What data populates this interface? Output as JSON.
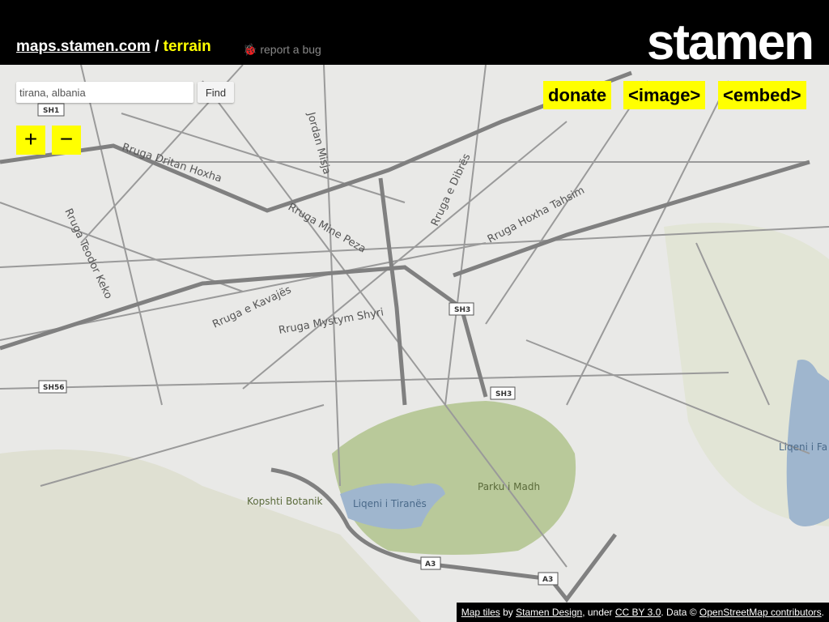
{
  "header": {
    "site_link": "maps.stamen.com",
    "separator": "/",
    "layer": "terrain",
    "report_bug": "report a bug",
    "logo": "stamen"
  },
  "search": {
    "value": "tirana, albania",
    "button": "Find"
  },
  "zoom": {
    "in": "+",
    "out": "−"
  },
  "actions": {
    "donate": "donate",
    "image": "<image>",
    "embed": "<embed>"
  },
  "attribution": {
    "map_tiles": "Map tiles",
    "by": " by ",
    "stamen_design": "Stamen Design",
    "under": ", under ",
    "license": "CC BY 3.0",
    "data": ". Data © ",
    "osm": "OpenStreetMap contributors",
    "end": "."
  },
  "map": {
    "colors": {
      "land": "#e9e9e7",
      "park": "#b9c99a",
      "water": "#9fb6ce",
      "road": "#9a9a9a",
      "major_road": "#7a7a7a"
    },
    "street_labels": [
      "Rruga Dritan Hoxha",
      "Jordan Misja",
      "Rruga e Dibrës",
      "Rruga Hoxha Tahsim",
      "Rruga Mine Peza",
      "Rruga Teodor Keko",
      "Rruga e Kavajës",
      "Rruga Mystym Shyri"
    ],
    "place_labels": [
      "Kopshti Botanik",
      "Liqeni i Tiranës",
      "Parku i Madh",
      "Liqeni i Fa"
    ],
    "shields": [
      "SH1",
      "SH3",
      "SH3",
      "SH56",
      "A3",
      "A3"
    ]
  }
}
